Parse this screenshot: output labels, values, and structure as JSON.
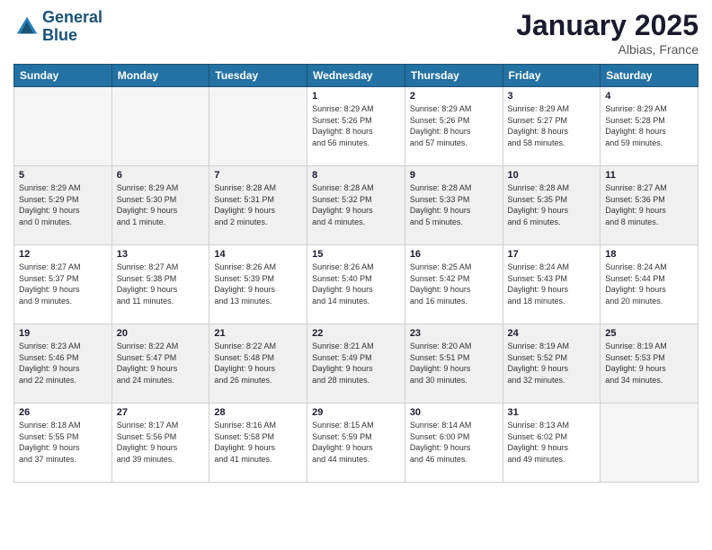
{
  "logo": {
    "line1": "General",
    "line2": "Blue"
  },
  "header": {
    "month": "January 2025",
    "location": "Albias, France"
  },
  "weekdays": [
    "Sunday",
    "Monday",
    "Tuesday",
    "Wednesday",
    "Thursday",
    "Friday",
    "Saturday"
  ],
  "weeks": [
    [
      {
        "day": "",
        "text": ""
      },
      {
        "day": "",
        "text": ""
      },
      {
        "day": "",
        "text": ""
      },
      {
        "day": "1",
        "text": "Sunrise: 8:29 AM\nSunset: 5:26 PM\nDaylight: 8 hours\nand 56 minutes."
      },
      {
        "day": "2",
        "text": "Sunrise: 8:29 AM\nSunset: 5:26 PM\nDaylight: 8 hours\nand 57 minutes."
      },
      {
        "day": "3",
        "text": "Sunrise: 8:29 AM\nSunset: 5:27 PM\nDaylight: 8 hours\nand 58 minutes."
      },
      {
        "day": "4",
        "text": "Sunrise: 8:29 AM\nSunset: 5:28 PM\nDaylight: 8 hours\nand 59 minutes."
      }
    ],
    [
      {
        "day": "5",
        "text": "Sunrise: 8:29 AM\nSunset: 5:29 PM\nDaylight: 9 hours\nand 0 minutes."
      },
      {
        "day": "6",
        "text": "Sunrise: 8:29 AM\nSunset: 5:30 PM\nDaylight: 9 hours\nand 1 minute."
      },
      {
        "day": "7",
        "text": "Sunrise: 8:28 AM\nSunset: 5:31 PM\nDaylight: 9 hours\nand 2 minutes."
      },
      {
        "day": "8",
        "text": "Sunrise: 8:28 AM\nSunset: 5:32 PM\nDaylight: 9 hours\nand 4 minutes."
      },
      {
        "day": "9",
        "text": "Sunrise: 8:28 AM\nSunset: 5:33 PM\nDaylight: 9 hours\nand 5 minutes."
      },
      {
        "day": "10",
        "text": "Sunrise: 8:28 AM\nSunset: 5:35 PM\nDaylight: 9 hours\nand 6 minutes."
      },
      {
        "day": "11",
        "text": "Sunrise: 8:27 AM\nSunset: 5:36 PM\nDaylight: 9 hours\nand 8 minutes."
      }
    ],
    [
      {
        "day": "12",
        "text": "Sunrise: 8:27 AM\nSunset: 5:37 PM\nDaylight: 9 hours\nand 9 minutes."
      },
      {
        "day": "13",
        "text": "Sunrise: 8:27 AM\nSunset: 5:38 PM\nDaylight: 9 hours\nand 11 minutes."
      },
      {
        "day": "14",
        "text": "Sunrise: 8:26 AM\nSunset: 5:39 PM\nDaylight: 9 hours\nand 13 minutes."
      },
      {
        "day": "15",
        "text": "Sunrise: 8:26 AM\nSunset: 5:40 PM\nDaylight: 9 hours\nand 14 minutes."
      },
      {
        "day": "16",
        "text": "Sunrise: 8:25 AM\nSunset: 5:42 PM\nDaylight: 9 hours\nand 16 minutes."
      },
      {
        "day": "17",
        "text": "Sunrise: 8:24 AM\nSunset: 5:43 PM\nDaylight: 9 hours\nand 18 minutes."
      },
      {
        "day": "18",
        "text": "Sunrise: 8:24 AM\nSunset: 5:44 PM\nDaylight: 9 hours\nand 20 minutes."
      }
    ],
    [
      {
        "day": "19",
        "text": "Sunrise: 8:23 AM\nSunset: 5:46 PM\nDaylight: 9 hours\nand 22 minutes."
      },
      {
        "day": "20",
        "text": "Sunrise: 8:22 AM\nSunset: 5:47 PM\nDaylight: 9 hours\nand 24 minutes."
      },
      {
        "day": "21",
        "text": "Sunrise: 8:22 AM\nSunset: 5:48 PM\nDaylight: 9 hours\nand 26 minutes."
      },
      {
        "day": "22",
        "text": "Sunrise: 8:21 AM\nSunset: 5:49 PM\nDaylight: 9 hours\nand 28 minutes."
      },
      {
        "day": "23",
        "text": "Sunrise: 8:20 AM\nSunset: 5:51 PM\nDaylight: 9 hours\nand 30 minutes."
      },
      {
        "day": "24",
        "text": "Sunrise: 8:19 AM\nSunset: 5:52 PM\nDaylight: 9 hours\nand 32 minutes."
      },
      {
        "day": "25",
        "text": "Sunrise: 8:19 AM\nSunset: 5:53 PM\nDaylight: 9 hours\nand 34 minutes."
      }
    ],
    [
      {
        "day": "26",
        "text": "Sunrise: 8:18 AM\nSunset: 5:55 PM\nDaylight: 9 hours\nand 37 minutes."
      },
      {
        "day": "27",
        "text": "Sunrise: 8:17 AM\nSunset: 5:56 PM\nDaylight: 9 hours\nand 39 minutes."
      },
      {
        "day": "28",
        "text": "Sunrise: 8:16 AM\nSunset: 5:58 PM\nDaylight: 9 hours\nand 41 minutes."
      },
      {
        "day": "29",
        "text": "Sunrise: 8:15 AM\nSunset: 5:59 PM\nDaylight: 9 hours\nand 44 minutes."
      },
      {
        "day": "30",
        "text": "Sunrise: 8:14 AM\nSunset: 6:00 PM\nDaylight: 9 hours\nand 46 minutes."
      },
      {
        "day": "31",
        "text": "Sunrise: 8:13 AM\nSunset: 6:02 PM\nDaylight: 9 hours\nand 49 minutes."
      },
      {
        "day": "",
        "text": ""
      }
    ]
  ]
}
